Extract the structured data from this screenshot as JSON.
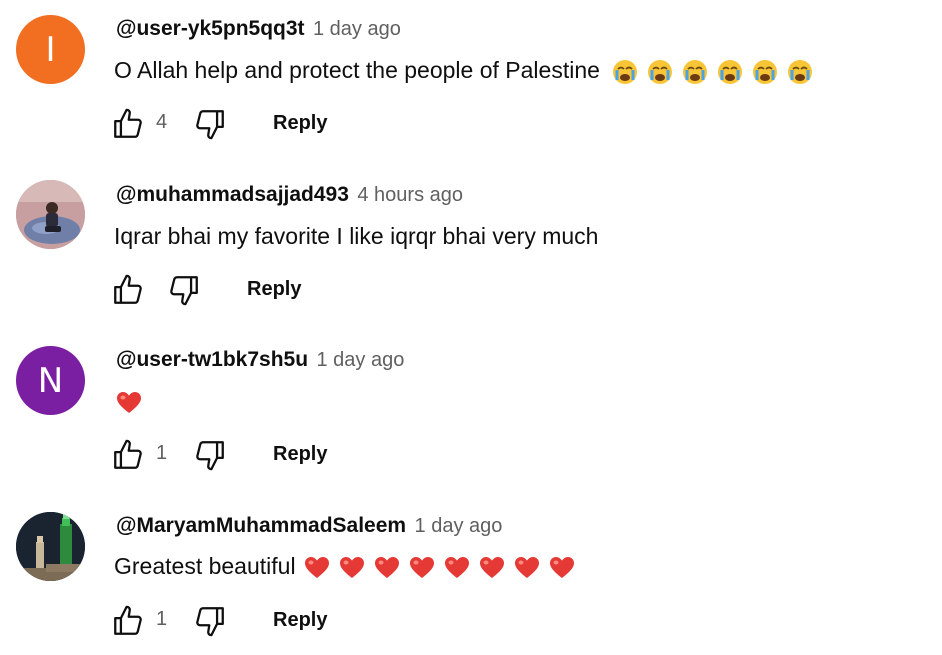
{
  "comments": [
    {
      "author": "@user-yk5pn5qq3t",
      "time": "1 day ago",
      "text": "O Allah help and protect the people of Palestine",
      "emoji": "crying-face",
      "emoji_count": 6,
      "avatar_letter": "I",
      "avatar_color": "#f26f21",
      "likes": "4",
      "reply_label": "Reply"
    },
    {
      "author": "@muhammadsajjad493",
      "time": "4 hours ago",
      "text": "Iqrar bhai my favorite  I like iqrqr bhai very much",
      "avatar_letter": "",
      "avatar_color": "#b98a8a",
      "likes": "",
      "reply_label": "Reply"
    },
    {
      "author": "@user-tw1bk7sh5u",
      "time": "1 day ago",
      "text": "",
      "emoji": "red-heart",
      "emoji_count": 1,
      "avatar_letter": "N",
      "avatar_color": "#7b1fa2",
      "likes": "1",
      "reply_label": "Reply"
    },
    {
      "author": "@MaryamMuhammadSaleem",
      "time": "1 day ago",
      "text": "Greatest beautiful",
      "emoji": "red-heart",
      "emoji_count": 8,
      "avatar_letter": "",
      "avatar_color": "#1a2430",
      "likes": "1",
      "reply_label": "Reply"
    }
  ],
  "colors": {
    "text": "#0f0f0f",
    "secondary": "#606060"
  }
}
